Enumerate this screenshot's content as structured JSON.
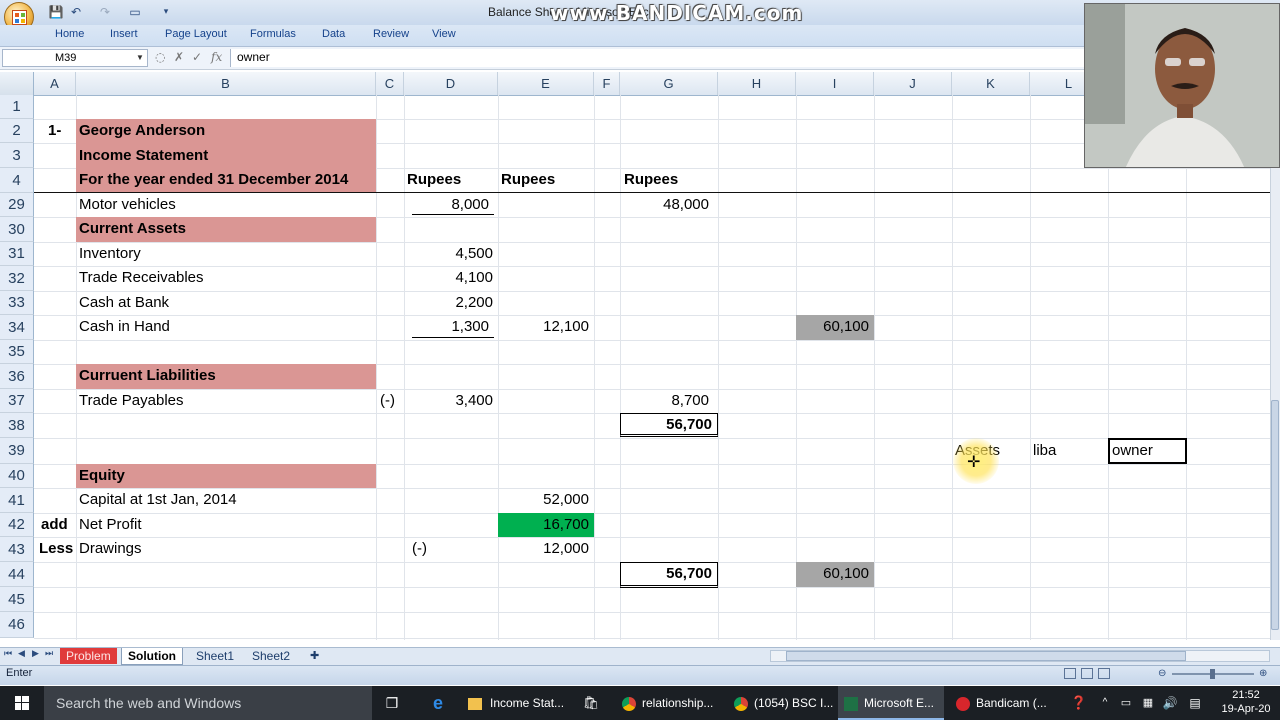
{
  "window": {
    "title": "Balance Sheet - Microsoft Excel",
    "watermark": "www.BANDICAM.com"
  },
  "quick_access": {
    "icons": [
      "save-icon",
      "undo-icon",
      "redo-icon",
      "print-preview-icon",
      "customize-icon"
    ]
  },
  "ribbon": {
    "tabs": [
      "Home",
      "Insert",
      "Page Layout",
      "Formulas",
      "Data",
      "Review",
      "View"
    ]
  },
  "formula_bar": {
    "name_box": "M39",
    "content": "owner"
  },
  "columns": [
    "A",
    "B",
    "C",
    "D",
    "E",
    "F",
    "G",
    "H",
    "I",
    "J",
    "K",
    "L"
  ],
  "rows": [
    "1",
    "2",
    "3",
    "4",
    "29",
    "30",
    "31",
    "32",
    "33",
    "34",
    "35",
    "36",
    "37",
    "38",
    "39",
    "40",
    "41",
    "42",
    "43",
    "44",
    "45",
    "46"
  ],
  "colors": {
    "header_fill": "#da9694",
    "highlight_green": "#00b050",
    "gray_fill": "#a6a6a6"
  },
  "cells": {
    "A2": "1-",
    "B2": "George Anderson",
    "B3": "Income Statement",
    "B4": "For the year ended 31 December 2014",
    "D4": "Rupees",
    "E4": "Rupees",
    "G4": "Rupees",
    "B29": "Motor vehicles",
    "D29": "8,000",
    "G29": "48,000",
    "B30": "Current Assets",
    "B31": "Inventory",
    "D31": "4,500",
    "B32": "Trade Receivables",
    "D32": "4,100",
    "B33": "Cash at Bank",
    "D33": "2,200",
    "B34": "Cash in Hand",
    "D34": "1,300",
    "E34": "12,100",
    "I34": "60,100",
    "B36": "Curruent Liabilities",
    "B37": "Trade Payables",
    "C37": "(-)",
    "D37": "3,400",
    "G37": "8,700",
    "G38": "56,700",
    "K39": "Assets",
    "L39": "liba",
    "M39": "owner",
    "B40": "Equity",
    "B41": "Capital at 1st Jan, 2014",
    "E41": "52,000",
    "A42": "add",
    "B42": "Net Profit",
    "E42": "16,700",
    "A43": "Less",
    "B43": "Drawings",
    "D43": "(-)",
    "E43": "12,000",
    "G44": "56,700",
    "I44": "60,100"
  },
  "sheets": {
    "tabs": [
      "Problem",
      "Solution",
      "Sheet1",
      "Sheet2"
    ],
    "active": "Solution"
  },
  "status": {
    "mode": "Enter"
  },
  "taskbar": {
    "search_placeholder": "Search the web and Windows",
    "items": [
      "Income Stat...",
      "relationship...",
      "(1054) BSC I...",
      "Microsoft E...",
      "Bandicam (..."
    ],
    "time": "21:52",
    "date": "19-Apr-20"
  }
}
